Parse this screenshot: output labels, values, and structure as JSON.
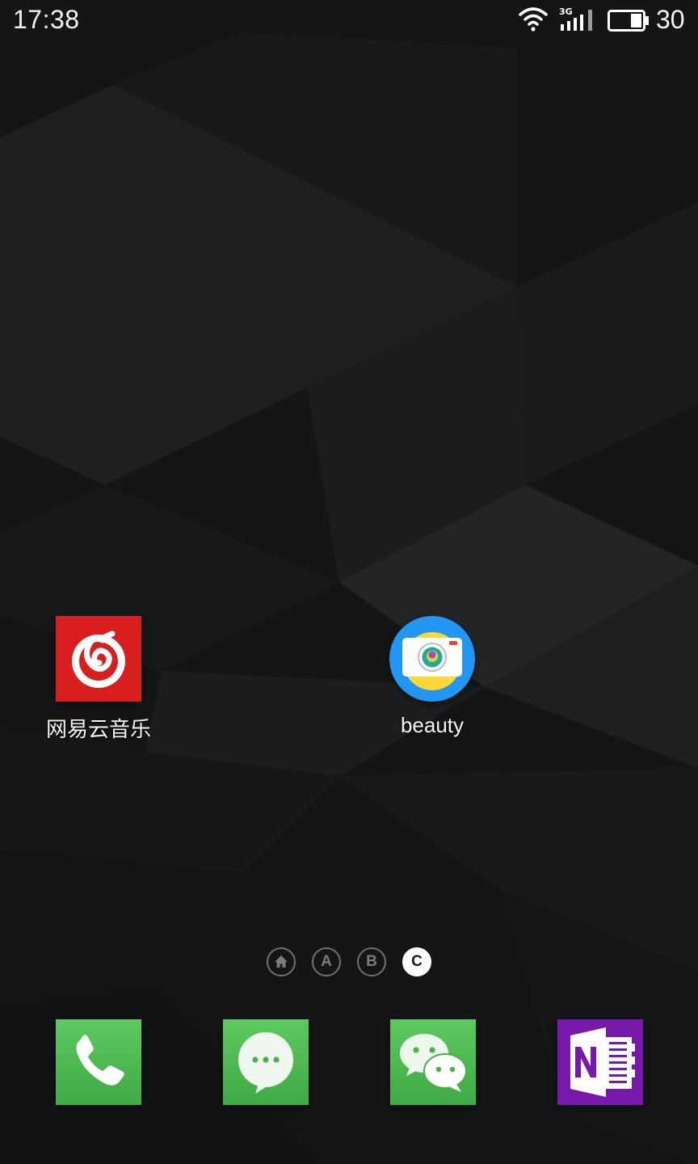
{
  "status_bar": {
    "time": "17:38",
    "network_type": "3G",
    "battery_level": "30",
    "icons": [
      "wifi-icon",
      "signal-icon",
      "battery-icon"
    ]
  },
  "home_screen": {
    "apps": [
      {
        "label": "网易云音乐",
        "icon": "netease-music-icon",
        "color": "#d81e1e"
      },
      {
        "label": "beauty",
        "icon": "camera-icon",
        "color": "#2196f3"
      }
    ],
    "page_indicator": {
      "pages": [
        "home",
        "A",
        "B",
        "C"
      ],
      "active": "C"
    }
  },
  "dock": {
    "apps": [
      {
        "icon": "phone-icon",
        "color": "#4caf50"
      },
      {
        "icon": "messages-icon",
        "color": "#4caf50"
      },
      {
        "icon": "wechat-icon",
        "color": "#4caf50"
      },
      {
        "icon": "onenote-icon",
        "color": "#7719aa"
      }
    ]
  }
}
